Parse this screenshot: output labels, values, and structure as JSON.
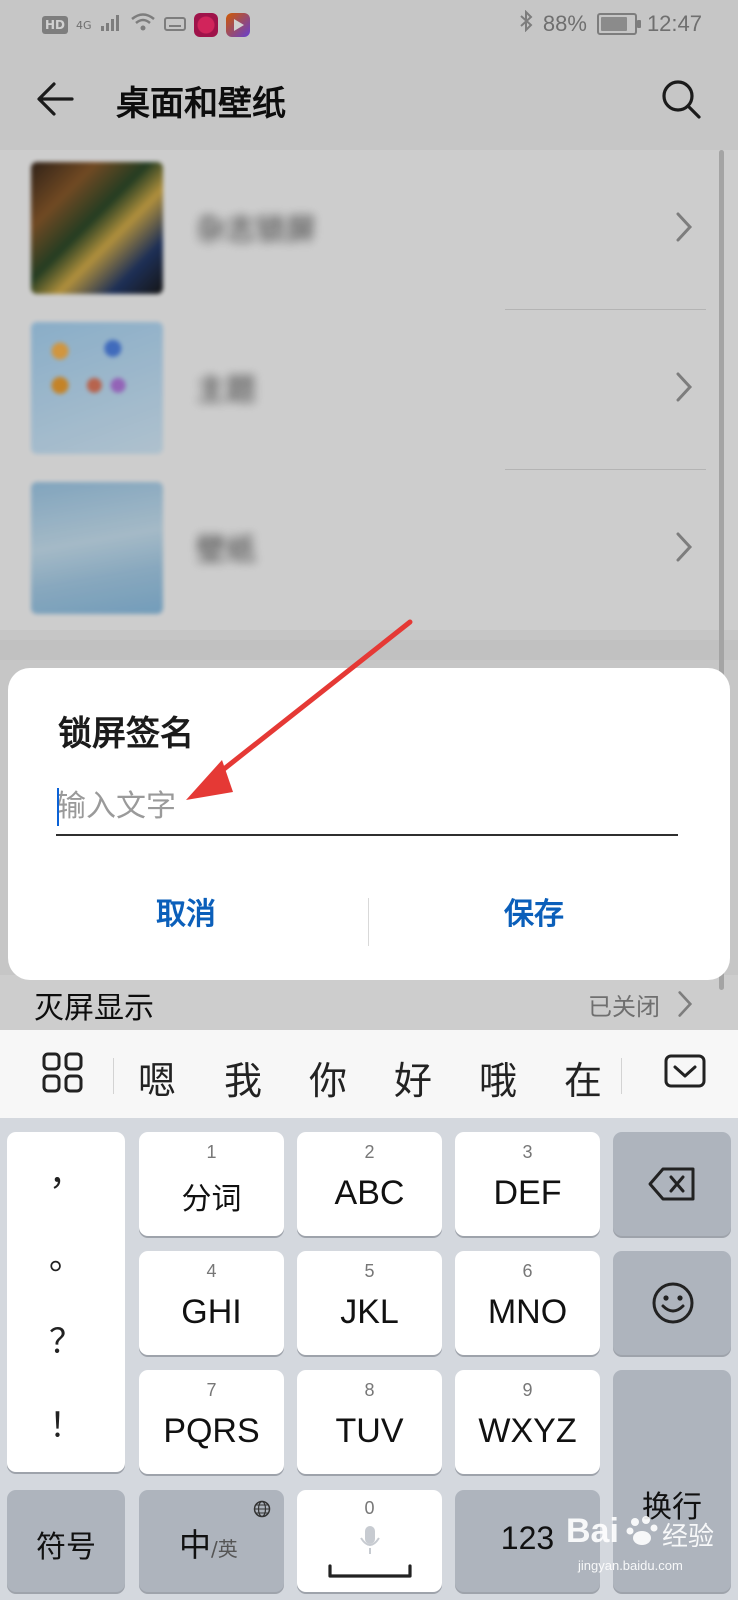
{
  "status_bar": {
    "left_badges": [
      "HD",
      "4G"
    ],
    "battery": "88%",
    "time": "12:47"
  },
  "header": {
    "title": "桌面和壁纸"
  },
  "settings_items": [
    {
      "label": "杂志锁屏"
    },
    {
      "label": "主题"
    },
    {
      "label": "壁纸"
    }
  ],
  "aod": {
    "label": "灭屏显示",
    "value": "已关闭"
  },
  "dialog": {
    "title": "锁屏签名",
    "input_value": "",
    "input_placeholder": "输入文字",
    "cancel_label": "取消",
    "save_label": "保存"
  },
  "candidates": [
    "嗯",
    "我",
    "你",
    "好",
    "哦",
    "在"
  ],
  "keyboard": {
    "punctuation": [
      "，",
      "。",
      "？",
      "！"
    ],
    "keys": [
      {
        "num": "1",
        "label": "分词"
      },
      {
        "num": "2",
        "label": "ABC"
      },
      {
        "num": "3",
        "label": "DEF"
      },
      {
        "num": "4",
        "label": "GHI"
      },
      {
        "num": "5",
        "label": "JKL"
      },
      {
        "num": "6",
        "label": "MNO"
      },
      {
        "num": "7",
        "label": "PQRS"
      },
      {
        "num": "8",
        "label": "TUV"
      },
      {
        "num": "9",
        "label": "WXYZ"
      }
    ],
    "symbols_label": "符号",
    "lang_main": "中",
    "lang_sub": "/英",
    "space_num": "0",
    "numbers_label": "123",
    "enter_label": "换行"
  },
  "watermark": {
    "brand": "Bai",
    "brand_cn": "经验",
    "url": "jingyan.baidu.com"
  },
  "colors": {
    "accent": "#0b5fba",
    "annotation_arrow": "#e53935"
  },
  "icons": [
    "back-arrow-icon",
    "search-icon",
    "chevron-right-icon",
    "grid-menu-icon",
    "keyboard-hide-icon",
    "backspace-icon",
    "emoji-icon",
    "globe-icon",
    "mic-icon",
    "bluetooth-icon",
    "wifi-icon"
  ]
}
